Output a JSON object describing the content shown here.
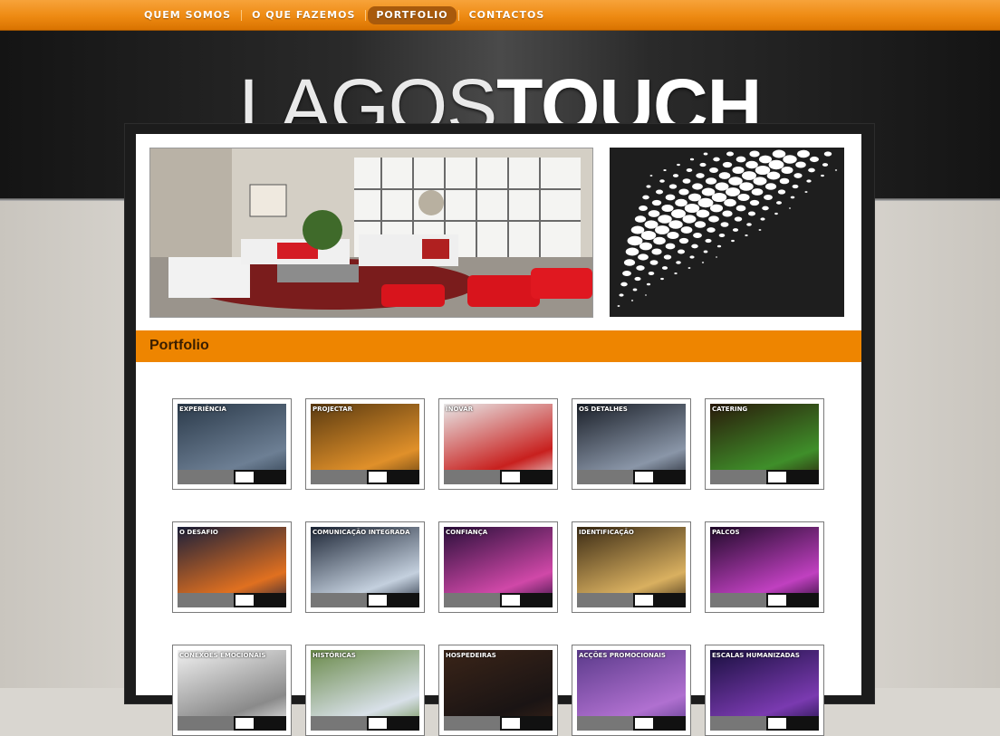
{
  "nav": {
    "items": [
      {
        "label": "QUEM SOMOS",
        "active": false
      },
      {
        "label": "O QUE FAZEMOS",
        "active": false
      },
      {
        "label": "PORTFOLIO",
        "active": true
      },
      {
        "label": "CONTACTOS",
        "active": false
      }
    ]
  },
  "logo": {
    "light": "LAGOS",
    "bold": "TOUCH"
  },
  "section": {
    "title": "Portfolio"
  },
  "colors": {
    "accent": "#ee8500",
    "header_dark": "#1c1c1c"
  },
  "portfolio": [
    {
      "caption": "EXPERIÊNCIA",
      "tone": [
        "#2b3a4a",
        "#6d7f94"
      ]
    },
    {
      "caption": "PROJECTAR",
      "tone": [
        "#5a3a10",
        "#e0902a"
      ]
    },
    {
      "caption": "INOVAR",
      "tone": [
        "#e8e8e8",
        "#c8201e"
      ]
    },
    {
      "caption": "OS DETALHES",
      "tone": [
        "#1a1f28",
        "#8a96a8"
      ]
    },
    {
      "caption": "CATERING",
      "tone": [
        "#2a1a0a",
        "#3f8f2a"
      ]
    },
    {
      "caption": "O DESAFIO",
      "tone": [
        "#1b1f3a",
        "#e07020"
      ]
    },
    {
      "caption": "COMUNICAÇÃO INTEGRADA",
      "tone": [
        "#1c2535",
        "#c4d0de"
      ]
    },
    {
      "caption": "CONFIANÇA",
      "tone": [
        "#2a0f3a",
        "#d048a8"
      ]
    },
    {
      "caption": "IDENTIFICAÇÃO",
      "tone": [
        "#3a2a14",
        "#d9b060"
      ]
    },
    {
      "caption": "PALCOS",
      "tone": [
        "#200a2a",
        "#c040c0"
      ]
    },
    {
      "caption": "CONEXÕES EMOCIONAIS",
      "tone": [
        "#f0f0f0",
        "#8a8a8a"
      ]
    },
    {
      "caption": "HISTÓRICAS",
      "tone": [
        "#6a8a4a",
        "#d8e0e8"
      ]
    },
    {
      "caption": "HOSPEDEIRAS",
      "tone": [
        "#3a2418",
        "#1a1414"
      ]
    },
    {
      "caption": "ACÇÕES PROMOCIONAIS",
      "tone": [
        "#5a3a8a",
        "#b070d0"
      ]
    },
    {
      "caption": "ESCALAS HUMANIZADAS",
      "tone": [
        "#1a1040",
        "#7a3ab0"
      ]
    }
  ]
}
